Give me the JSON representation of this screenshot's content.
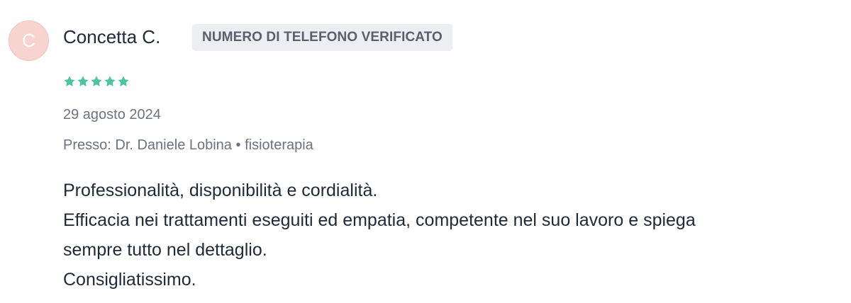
{
  "review": {
    "avatar_initial": "C",
    "author_name": "Concetta C.",
    "verified_badge": "NUMERO DI TELEFONO VERIFICATO",
    "rating": 5,
    "rating_max": 5,
    "star_color": "#4ec3a0",
    "date": "29 agosto 2024",
    "location_prefix": "Presso:",
    "doctor": "Dr. Daniele Lobina",
    "separator": "•",
    "service": "fisioterapia",
    "body_lines": [
      "Professionalità, disponibilità e cordialità.",
      "Efficacia nei trattamenti eseguiti ed empatia, competente nel suo lavoro e spiega",
      "sempre tutto nel dettaglio.",
      "Consigliatissimo."
    ]
  }
}
